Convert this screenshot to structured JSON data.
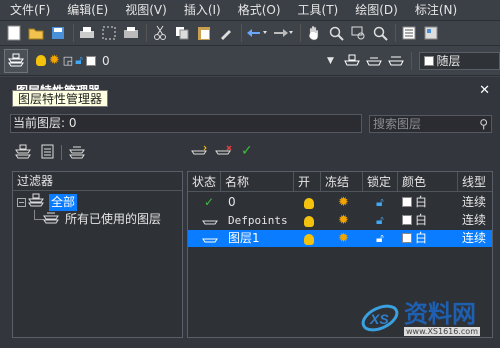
{
  "menubar": {
    "items": [
      "文件(F)",
      "编辑(E)",
      "视图(V)",
      "插入(I)",
      "格式(O)",
      "工具(T)",
      "绘图(D)",
      "标注(N)"
    ]
  },
  "layer_toolbar": {
    "current_layer": "0",
    "linetype_combo": "随层"
  },
  "panel": {
    "title": "图层特性管理器",
    "tooltip": "图层特性管理器",
    "current_layer_label": "当前图层: 0",
    "search_placeholder": "搜索图层"
  },
  "filters": {
    "header": "过滤器",
    "tree": [
      {
        "label": "全部",
        "selected": true
      },
      {
        "label": "所有已使用的图层",
        "selected": false
      }
    ]
  },
  "table": {
    "columns": [
      "状态",
      "名称",
      "开",
      "冻结",
      "锁定",
      "颜色",
      "线型"
    ],
    "rows": [
      {
        "name": "0",
        "color": "白",
        "linetype": "连续",
        "selected": false
      },
      {
        "name": "Defpoints",
        "color": "白",
        "linetype": "连续",
        "selected": false
      },
      {
        "name": "图层1",
        "color": "白",
        "linetype": "连续",
        "selected": true
      }
    ]
  },
  "watermark": {
    "text": "资料网",
    "sub": "www.XS1616.com"
  },
  "colors": {
    "accent": "#0a7cff",
    "bulb": "#f4c20d",
    "sun": "#f4a400"
  }
}
